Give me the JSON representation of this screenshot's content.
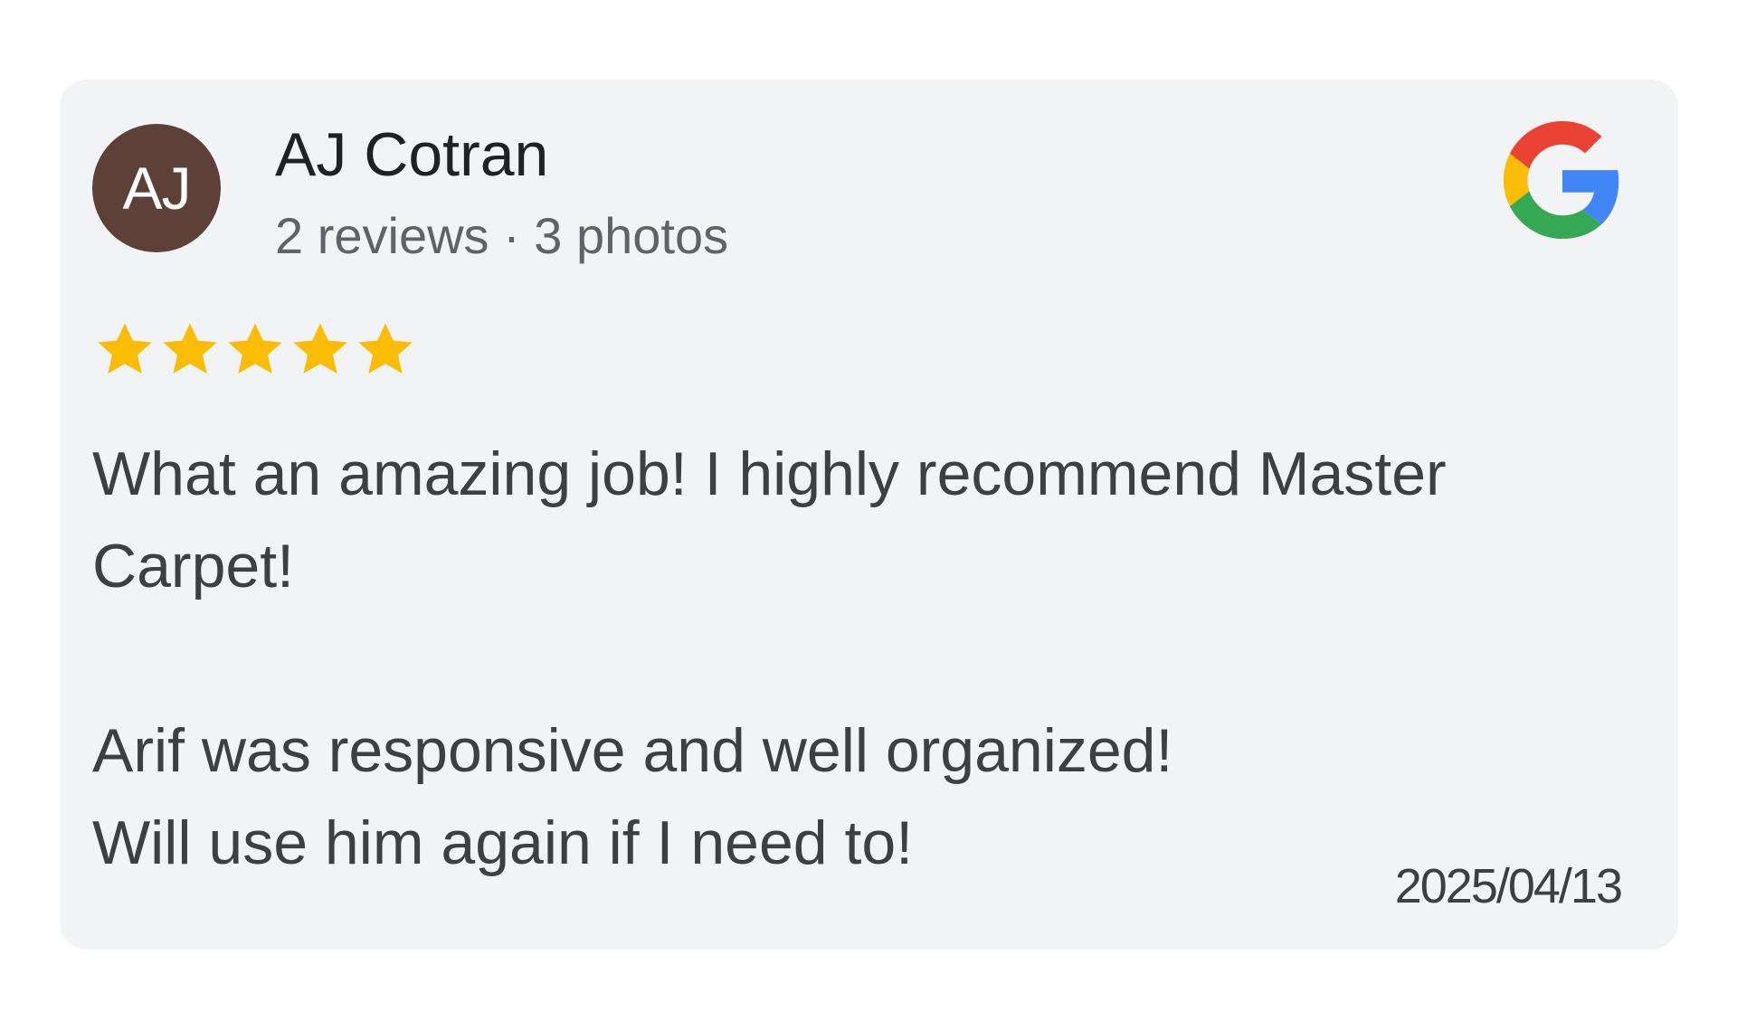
{
  "review": {
    "author": {
      "initials": "AJ",
      "name": "AJ Cotran",
      "meta": "2 reviews · 3 photos",
      "avatar_color": "#5d4037"
    },
    "source_icon": "google-logo-icon",
    "rating": 5,
    "rating_max": 5,
    "star_color": "#fbbc04",
    "text": "What an amazing job! I highly recommend Master Carpet!\n\nArif was responsive and well organized!\nWill use him again if I need to!",
    "date": "2025/04/13"
  }
}
